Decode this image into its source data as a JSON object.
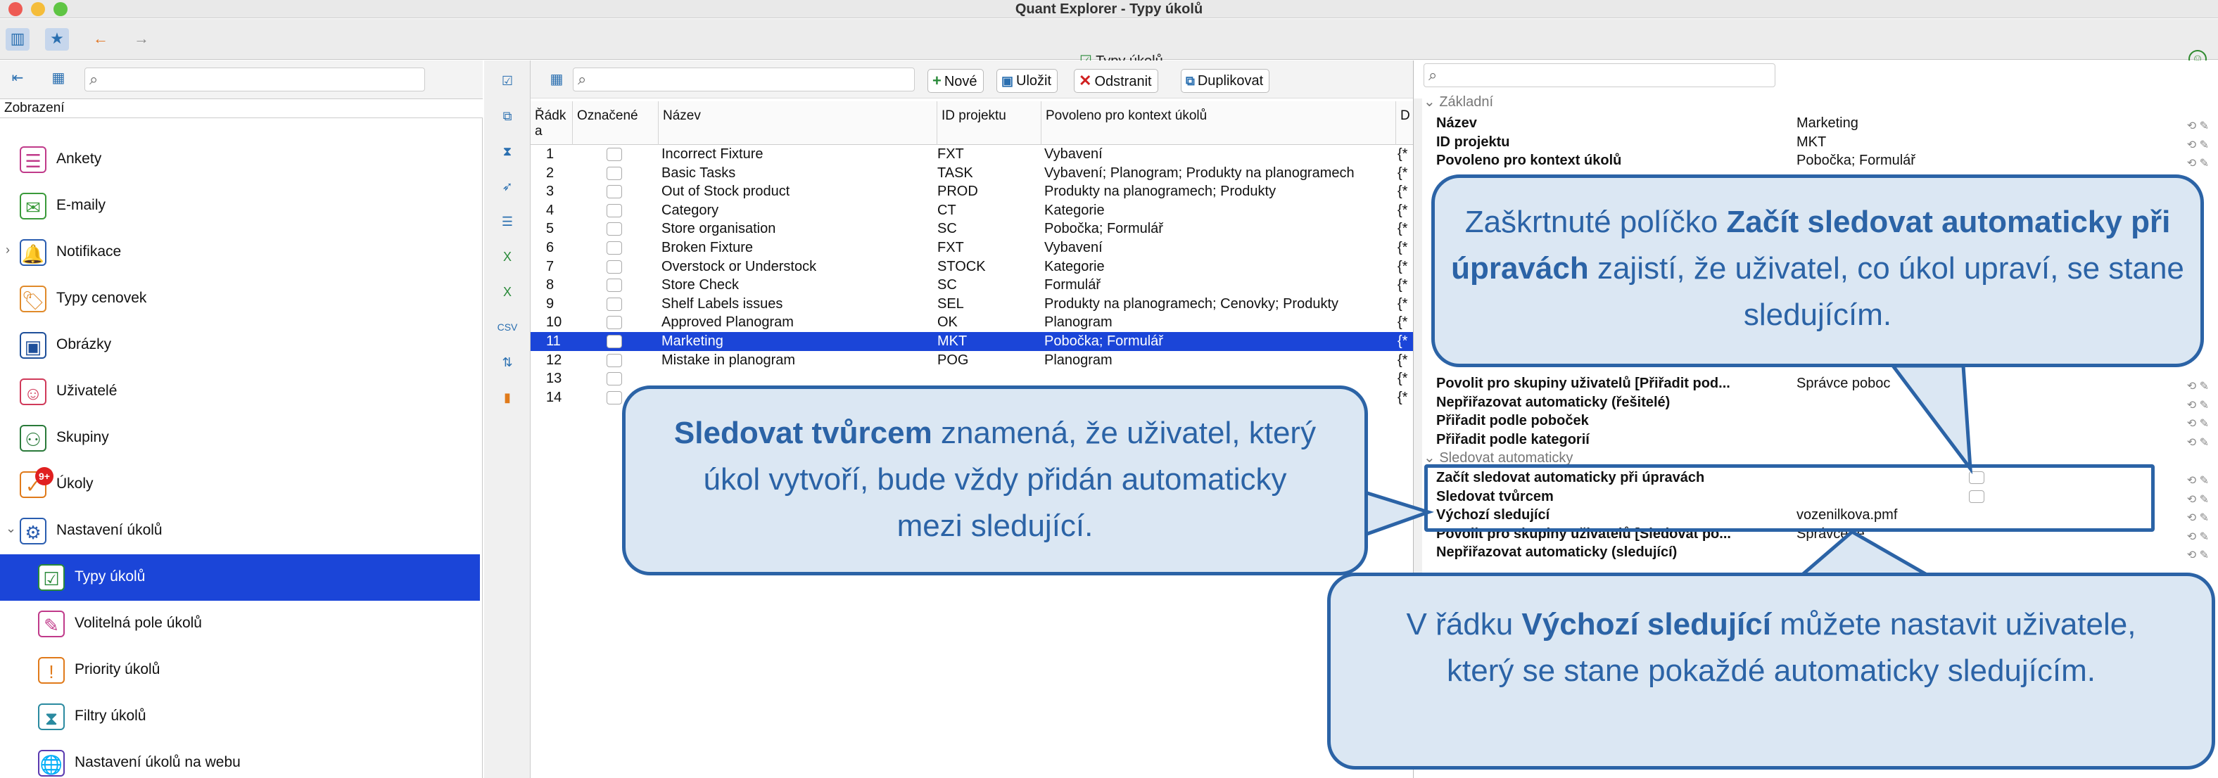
{
  "window": {
    "title": "Quant Explorer - Typy úkolů",
    "document_title": "Typy úkolů"
  },
  "left": {
    "search_placeholder": "",
    "section_label": "Zobrazení",
    "items": [
      {
        "label": "Ankety",
        "icon": "survey-icon",
        "color": "#c03a8a"
      },
      {
        "label": "E-maily",
        "icon": "email-icon",
        "color": "#3a9a3a"
      },
      {
        "label": "Notifikace",
        "icon": "bell-icon",
        "color": "#2a5db0"
      },
      {
        "label": "Typy cenovek",
        "icon": "price-tag-icon",
        "color": "#e08a2a"
      },
      {
        "label": "Obrázky",
        "icon": "image-icon",
        "color": "#1e4f9a"
      },
      {
        "label": "Uživatelé",
        "icon": "user-icon",
        "color": "#d03a5a"
      },
      {
        "label": "Skupiny",
        "icon": "group-icon",
        "color": "#2a7a3a"
      },
      {
        "label": "Úkoly",
        "icon": "task-icon",
        "color": "#e07a1a",
        "badge": "9+"
      },
      {
        "label": "Nastavení úkolů",
        "icon": "task-settings-icon",
        "color": "#2a5db0"
      },
      {
        "label": "Typy úkolů",
        "icon": "task-type-icon",
        "color": "#2a8a3a",
        "selected": true
      },
      {
        "label": "Volitelná pole úkolů",
        "icon": "task-fields-icon",
        "color": "#c03a8a"
      },
      {
        "label": "Priority úkolů",
        "icon": "task-priority-icon",
        "color": "#e07a1a"
      },
      {
        "label": "Filtry úkolů",
        "icon": "task-filter-icon",
        "color": "#2a8aa0"
      },
      {
        "label": "Nastavení úkolů na webu",
        "icon": "task-web-icon",
        "color": "#5a3ab0"
      }
    ]
  },
  "toolbar": {
    "new": "Nové",
    "save": "Uložit",
    "delete": "Odstranit",
    "duplicate": "Duplikovat"
  },
  "table": {
    "headers": [
      "Řádk a",
      "Označené",
      "Název",
      "ID projektu",
      "Povoleno pro kontext úkolů",
      "D"
    ],
    "rows": [
      {
        "n": "1",
        "name": "Incorrect Fixture",
        "id": "FXT",
        "ctx": "Vybavení",
        "d": "{*"
      },
      {
        "n": "2",
        "name": "Basic Tasks",
        "id": "TASK",
        "ctx": "Vybavení; Planogram; Produkty na planogramech",
        "d": "{*"
      },
      {
        "n": "3",
        "name": "Out of Stock product",
        "id": "PROD",
        "ctx": "Produkty na planogramech; Produkty",
        "d": "{*"
      },
      {
        "n": "4",
        "name": "Category",
        "id": "CT",
        "ctx": "Kategorie",
        "d": "{*"
      },
      {
        "n": "5",
        "name": "Store organisation",
        "id": "SC",
        "ctx": "Pobočka; Formulář",
        "d": "{*"
      },
      {
        "n": "6",
        "name": "Broken Fixture",
        "id": "FXT",
        "ctx": "Vybavení",
        "d": "{*"
      },
      {
        "n": "7",
        "name": "Overstock or Understock",
        "id": "STOCK",
        "ctx": "Kategorie",
        "d": "{*"
      },
      {
        "n": "8",
        "name": "Store Check",
        "id": "SC",
        "ctx": "Formulář",
        "d": "{*"
      },
      {
        "n": "9",
        "name": "Shelf Labels issues",
        "id": "SEL",
        "ctx": "Produkty na planogramech; Cenovky; Produkty",
        "d": "{*"
      },
      {
        "n": "10",
        "name": "Approved Planogram",
        "id": "OK",
        "ctx": "Planogram",
        "d": "{*"
      },
      {
        "n": "11",
        "name": "Marketing",
        "id": "MKT",
        "ctx": "Pobočka; Formulář",
        "d": "{*",
        "selected": true
      },
      {
        "n": "12",
        "name": "Mistake in planogram",
        "id": "POG",
        "ctx": "Planogram",
        "d": "{*"
      },
      {
        "n": "13",
        "name": "",
        "id": "",
        "ctx": "",
        "d": "{*"
      },
      {
        "n": "14",
        "name": "",
        "id": "",
        "ctx": "",
        "d": "{*"
      }
    ]
  },
  "props": {
    "section_basic": "Základní",
    "basic": [
      {
        "k": "Název",
        "v": "Marketing"
      },
      {
        "k": "ID projektu",
        "v": "MKT"
      },
      {
        "k": "Povoleno pro kontext úkolů",
        "v": "Pobočka; Formulář"
      }
    ],
    "mid": [
      {
        "k": "Povolit pro skupiny uživatelů [Přiřadit pod...",
        "v": "Správce poboc"
      },
      {
        "k": "Nepřiřazovat automaticky (řešitelé)",
        "v": ""
      },
      {
        "k": "Přiřadit podle poboček",
        "v": ""
      },
      {
        "k": "Přiřadit podle kategorií",
        "v": ""
      }
    ],
    "section_follow": "Sledovat automaticky",
    "follow": [
      {
        "k": "Začít sledovat automaticky při úpravách",
        "v": ""
      },
      {
        "k": "Sledovat tvůrcem",
        "v": ""
      },
      {
        "k": "Výchozí sledující",
        "v": "vozenilkova.pmf"
      },
      {
        "k": "Povolit pro skupiny uživatelů [Sledovat po...",
        "v": "Správce re"
      },
      {
        "k": "Nepřiřazovat automaticky (sledující)",
        "v": ""
      }
    ]
  },
  "callouts": {
    "c1_pre": "Zaškrtnuté políčko ",
    "c1_bold": "Začít sledovat automaticky při úpravách",
    "c1_post": " zajistí, že uživatel, co úkol upraví, se stane sledujícím.",
    "c2_bold": "Sledovat tvůrcem",
    "c2_post": " znamená, že uživatel, který úkol vytvoří, bude vždy přidán automaticky mezi sledující.",
    "c3_pre": "V řádku ",
    "c3_bold": "Výchozí sledující",
    "c3_post": " můžete nastavit uživatele, který se stane pokaždé automaticky sledujícím."
  }
}
